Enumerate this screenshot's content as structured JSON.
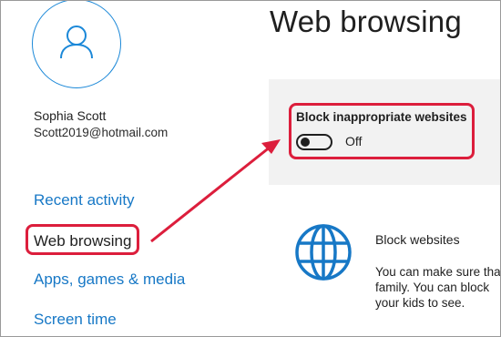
{
  "user": {
    "name": "Sophia Scott",
    "email": "Scott2019@hotmail.com"
  },
  "nav": {
    "recent_activity": "Recent activity",
    "web_browsing": "Web browsing",
    "apps_games_media": "Apps, games & media",
    "screen_time": "Screen time"
  },
  "page": {
    "title": "Web browsing"
  },
  "block_inappropriate": {
    "label": "Block inappropriate websites",
    "toggle_state": "Off",
    "toggle_on": false
  },
  "block_websites": {
    "title": "Block websites",
    "description_lines": [
      "You can make sure tha",
      "family. You can block",
      "your kids to see."
    ]
  },
  "colors": {
    "accent": "#1778c6",
    "highlight": "#dc1e3c",
    "card_bg": "#f2f2f2"
  },
  "icons": [
    "user-avatar-icon",
    "globe-icon",
    "annotation-arrow"
  ]
}
